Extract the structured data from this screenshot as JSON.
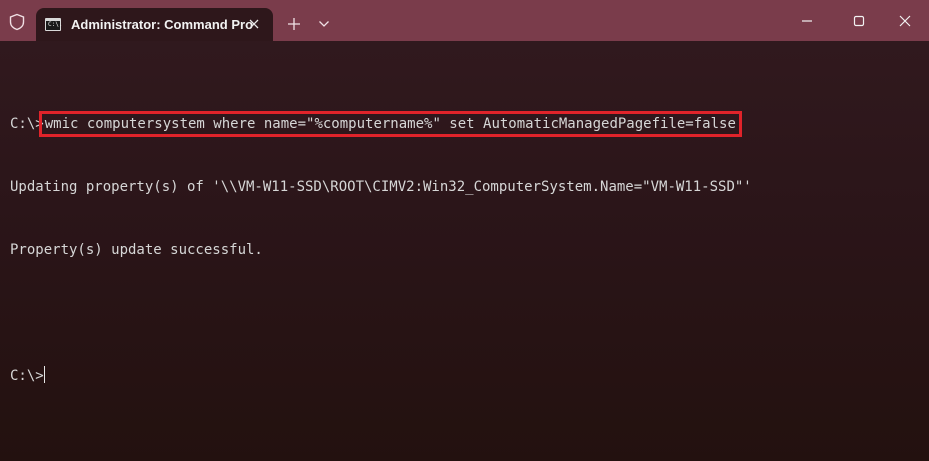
{
  "window": {
    "tab_title": "Administrator: Command Pro",
    "tab_icon_text": "C:\\."
  },
  "terminal": {
    "lines": [
      {
        "prompt": "C:\\>",
        "command": "wmic computersystem where name=\"%computername%\" set AutomaticManagedPagefile=false"
      },
      {
        "text": "Updating property(s) of '\\\\VM-W11-SSD\\ROOT\\CIMV2:Win32_ComputerSystem.Name=\"VM-W11-SSD\"'"
      },
      {
        "text": "Property(s) update successful."
      },
      {
        "text": ""
      },
      {
        "prompt": "C:\\>"
      }
    ]
  },
  "colors": {
    "titlebar": "#7a3c4b",
    "tab_background": "#2e171b",
    "terminal_background": "#2b1519",
    "terminal_text": "#d6d6d6",
    "highlight": "#e0232a"
  }
}
